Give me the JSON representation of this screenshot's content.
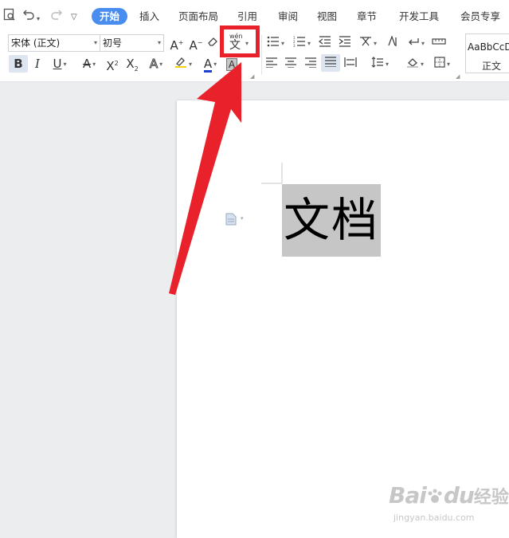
{
  "quick_access": {
    "print_preview_icon": "print-preview-icon",
    "undo_icon": "undo-icon",
    "redo_icon": "redo-icon",
    "customize_icon": "chevron-down-icon"
  },
  "tabs": [
    "开始",
    "插入",
    "页面布局",
    "引用",
    "审阅",
    "视图",
    "章节",
    "开发工具",
    "会员专享"
  ],
  "active_tab": "开始",
  "ribbon": {
    "font_name": "宋体 (正文)",
    "font_size": "初号",
    "phonetic_guide_label": "wén",
    "phonetic_guide_char": "文",
    "style_sample": "AaBbCcDd",
    "style_name": "正文"
  },
  "document": {
    "text": "文档"
  },
  "annotation": {
    "color": "#e8212b"
  },
  "watermark": {
    "brand": "Bai",
    "paw": "du",
    "suffix": "经验",
    "url": "jingyan.baidu.com"
  },
  "colors": {
    "accent": "#4a8df0",
    "font_color_bar": "#1f3fcf",
    "highlight_bar": "#f5d200",
    "annotation_red": "#e8212b",
    "selection_gray": "#c6c6c6"
  }
}
